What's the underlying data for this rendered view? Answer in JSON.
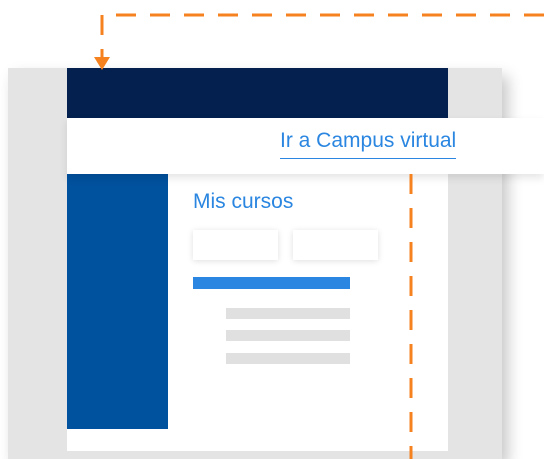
{
  "link": {
    "label": "Ir a Campus virtual"
  },
  "main": {
    "section_title": "Mis cursos"
  },
  "colors": {
    "header": "#03204f",
    "sidebar": "#00519e",
    "accent": "#2a86e0",
    "connector": "#f5821f",
    "placeholder": "#e0e0e0"
  },
  "icons": {
    "arrow": "arrow-down-icon"
  }
}
